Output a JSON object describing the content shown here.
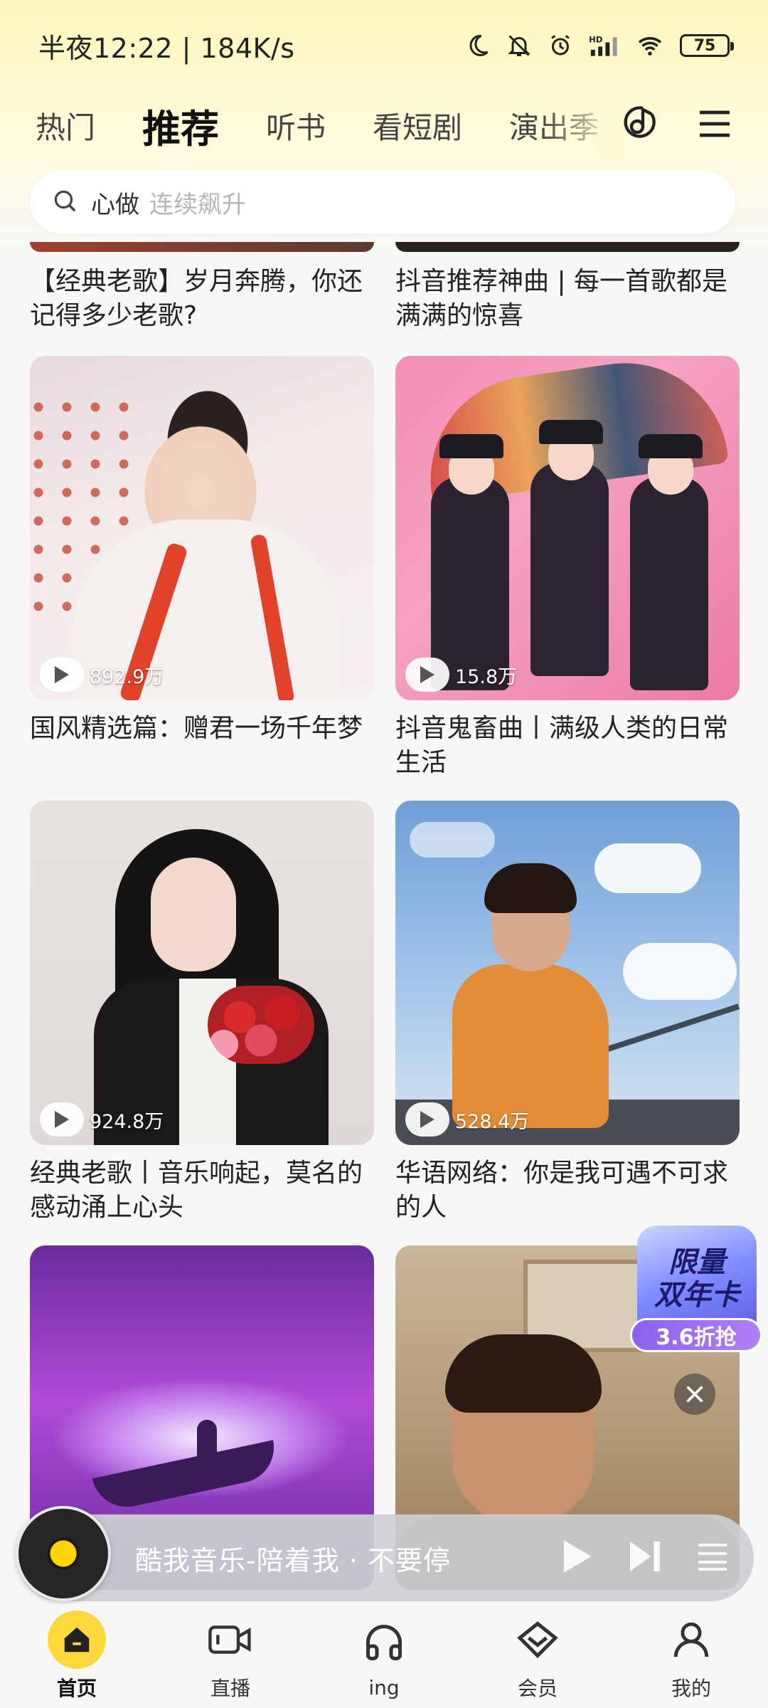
{
  "status_bar": {
    "time_speed": "半夜12:22 | 184K/s",
    "battery": "75",
    "icons": [
      "moon-icon",
      "bell-mute-icon",
      "alarm-icon",
      "signal-hd-icon",
      "wifi-icon",
      "battery-icon"
    ]
  },
  "tabs": [
    {
      "label": "热门",
      "active": false
    },
    {
      "label": "推荐",
      "active": true
    },
    {
      "label": "听书",
      "active": false
    },
    {
      "label": "看短剧",
      "active": false
    },
    {
      "label": "演出季",
      "active": false
    }
  ],
  "top_icons": [
    "voice-search-icon",
    "menu-icon"
  ],
  "search": {
    "hot_word": "心做",
    "hint": "连续飙升"
  },
  "feed": {
    "top_titles": [
      "【经典老歌】岁月奔腾，你还记得多少老歌?",
      "抖音推荐神曲 | 每一首歌都是满满的惊喜"
    ],
    "cards": [
      {
        "title": "国风精选篇：赠君一场千年梦",
        "plays": "892.9万"
      },
      {
        "title": "抖音鬼畜曲丨满级人类的日常生活",
        "plays": "15.8万"
      },
      {
        "title": "经典老歌丨音乐响起，莫名的感动涌上心头",
        "plays": "924.8万"
      },
      {
        "title": "华语网络：你是我可遇不可求的人",
        "plays": "528.4万"
      }
    ]
  },
  "promo": {
    "line1": "限量",
    "line2": "双年卡",
    "pill": "3.6折抢"
  },
  "player": {
    "title": "酷我音乐-陪着我 · 不要停"
  },
  "bottom_nav": [
    {
      "label": "首页",
      "icon": "home-icon",
      "active": true
    },
    {
      "label": "直播",
      "icon": "live-camera-icon",
      "active": false
    },
    {
      "label": "ing",
      "icon": "headphones-icon",
      "active": false
    },
    {
      "label": "会员",
      "icon": "vip-diamond-icon",
      "active": false
    },
    {
      "label": "我的",
      "icon": "profile-icon",
      "active": false
    }
  ],
  "colors": {
    "accent_yellow": "#ffd93c",
    "header_bg": "#fff7bd",
    "page_bg": "#f7f7f7"
  }
}
